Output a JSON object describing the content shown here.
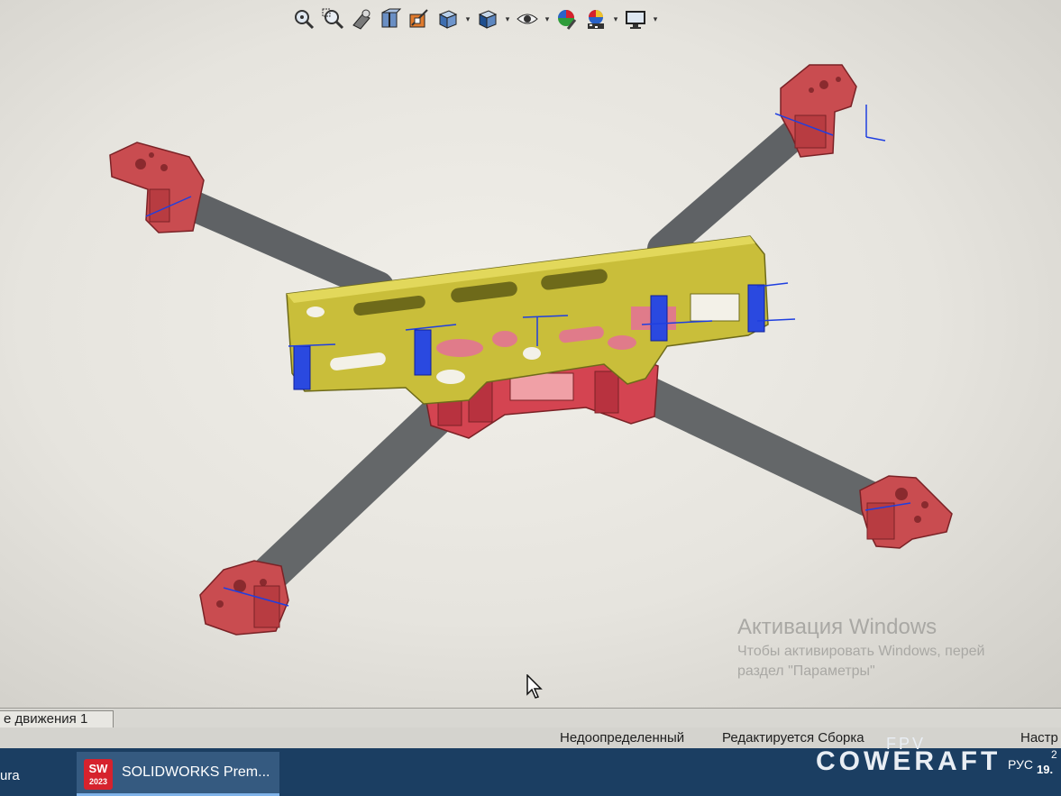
{
  "toolbar": {
    "icons": [
      "zoom-to-fit-icon",
      "zoom-to-area-icon",
      "previous-view-icon",
      "section-view-icon",
      "dynamic-annotation-icon",
      "view-orientation-icon",
      "display-style-icon",
      "hide-show-icon",
      "edit-appearance-icon",
      "apply-scene-icon",
      "view-settings-icon"
    ]
  },
  "viewport": {
    "activation_title": "Активация Windows",
    "activation_line1": "Чтобы активировать Windows, перей",
    "activation_line2": "раздел \"Параметры\""
  },
  "model_tabs": {
    "motion_study": "е движения 1"
  },
  "status": {
    "definition": "Недоопределенный",
    "mode": "Редактируется Сборка",
    "custom": "Настр"
  },
  "taskbar": {
    "left_text": "ura",
    "app_label": "SOLIDWORKS Prem...",
    "logo_top": "SW",
    "logo_year": "2023",
    "lang": "РУС",
    "time": "2",
    "date": "19."
  },
  "watermark": {
    "line1": "FPV",
    "line2": "COWERAFT"
  },
  "colors": {
    "frame_plate": "#c9be3a",
    "standoffs": "#d44451",
    "arm_tube": "#6c6f72",
    "motor_mount": "#c94c50",
    "mates": "#1f3fe0",
    "taskbar": "#1b3e62"
  }
}
